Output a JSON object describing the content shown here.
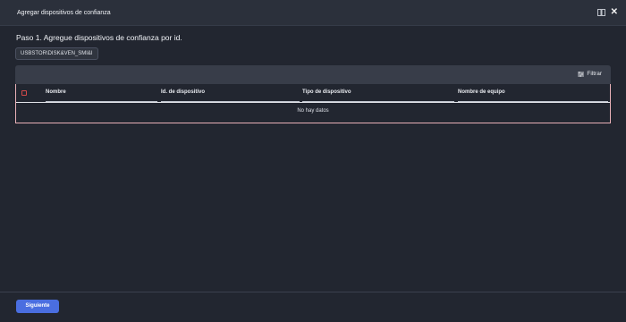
{
  "window": {
    "title": "Agregar dispositivos de confianza",
    "icons": [
      "book-icon",
      "close-icon"
    ]
  },
  "step": {
    "heading": "Paso 1. Agregue dispositivos de confianza por id."
  },
  "chip": {
    "value": "USBSTOR\\DISK&VEN_SMI&I"
  },
  "toolbar": {
    "filter_label": "Filtrar"
  },
  "table": {
    "columns": [
      "Nombre",
      "Id. de dispositivo",
      "Tipo de dispositivo",
      "Nombre de equipo"
    ],
    "empty_text": "No hay datos"
  },
  "footer": {
    "next_label": "Siguiente"
  },
  "colors": {
    "background": "#222630",
    "titlebar": "#2b303b",
    "accent": "#4a6ee0",
    "table_border": "#e8b0b6"
  }
}
